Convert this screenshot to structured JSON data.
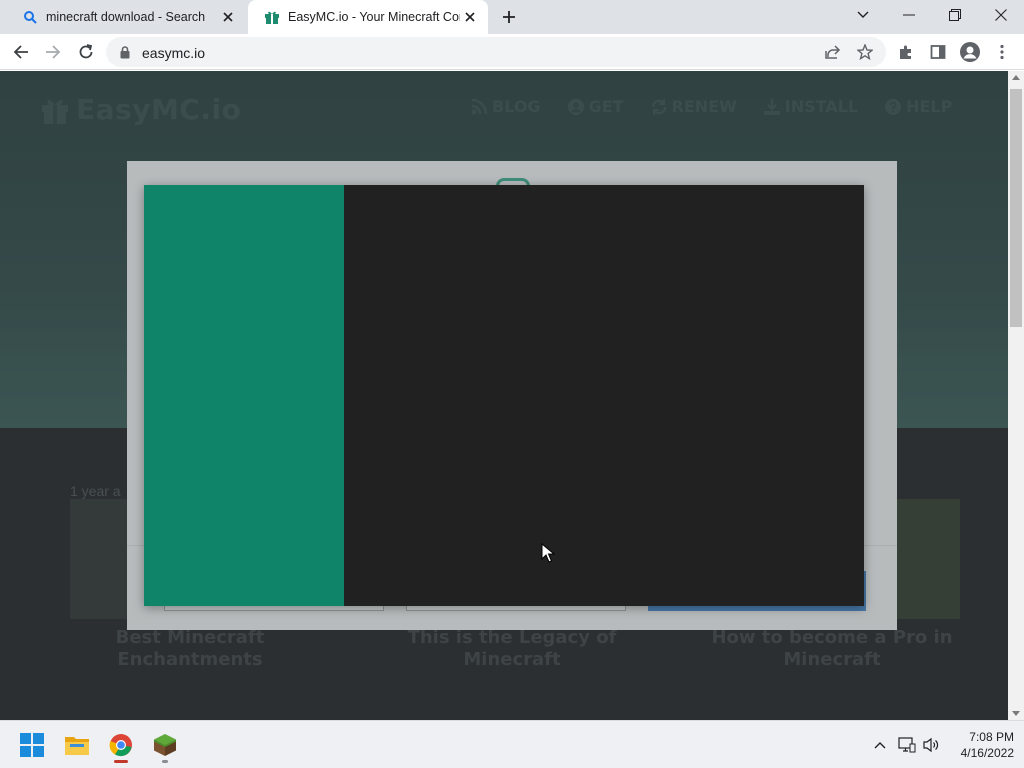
{
  "browser": {
    "tabs": [
      {
        "title": "minecraft download - Search",
        "active": false,
        "favicon": "search-icon"
      },
      {
        "title": "EasyMC.io - Your Minecraft Com",
        "active": true,
        "favicon": "gift-icon"
      }
    ],
    "address_bar": {
      "url": "easymc.io"
    }
  },
  "website": {
    "logo_text": "EasyMC.io",
    "nav": [
      {
        "label": "BLOG",
        "icon": "rss-icon"
      },
      {
        "label": "GET",
        "icon": "user-circle-icon"
      },
      {
        "label": "RENEW",
        "icon": "refresh-icon"
      },
      {
        "label": "INSTALL",
        "icon": "download-icon"
      },
      {
        "label": "HELP",
        "icon": "question-icon"
      }
    ],
    "time_ago": "1 year a",
    "posts": [
      {
        "title": "Best Minecraft Enchantments"
      },
      {
        "title": "This is the Legacy of Minecraft"
      },
      {
        "title": "How to become a Pro in Minecraft"
      }
    ]
  },
  "modal": {
    "sidebar_color": "#0f8469",
    "content_color": "#212121"
  },
  "taskbar": {
    "apps": [
      "windows-start-icon",
      "file-explorer-icon",
      "chrome-icon",
      "minecraft-icon"
    ],
    "clock": {
      "time": "7:08 PM",
      "date": "4/16/2022"
    }
  }
}
